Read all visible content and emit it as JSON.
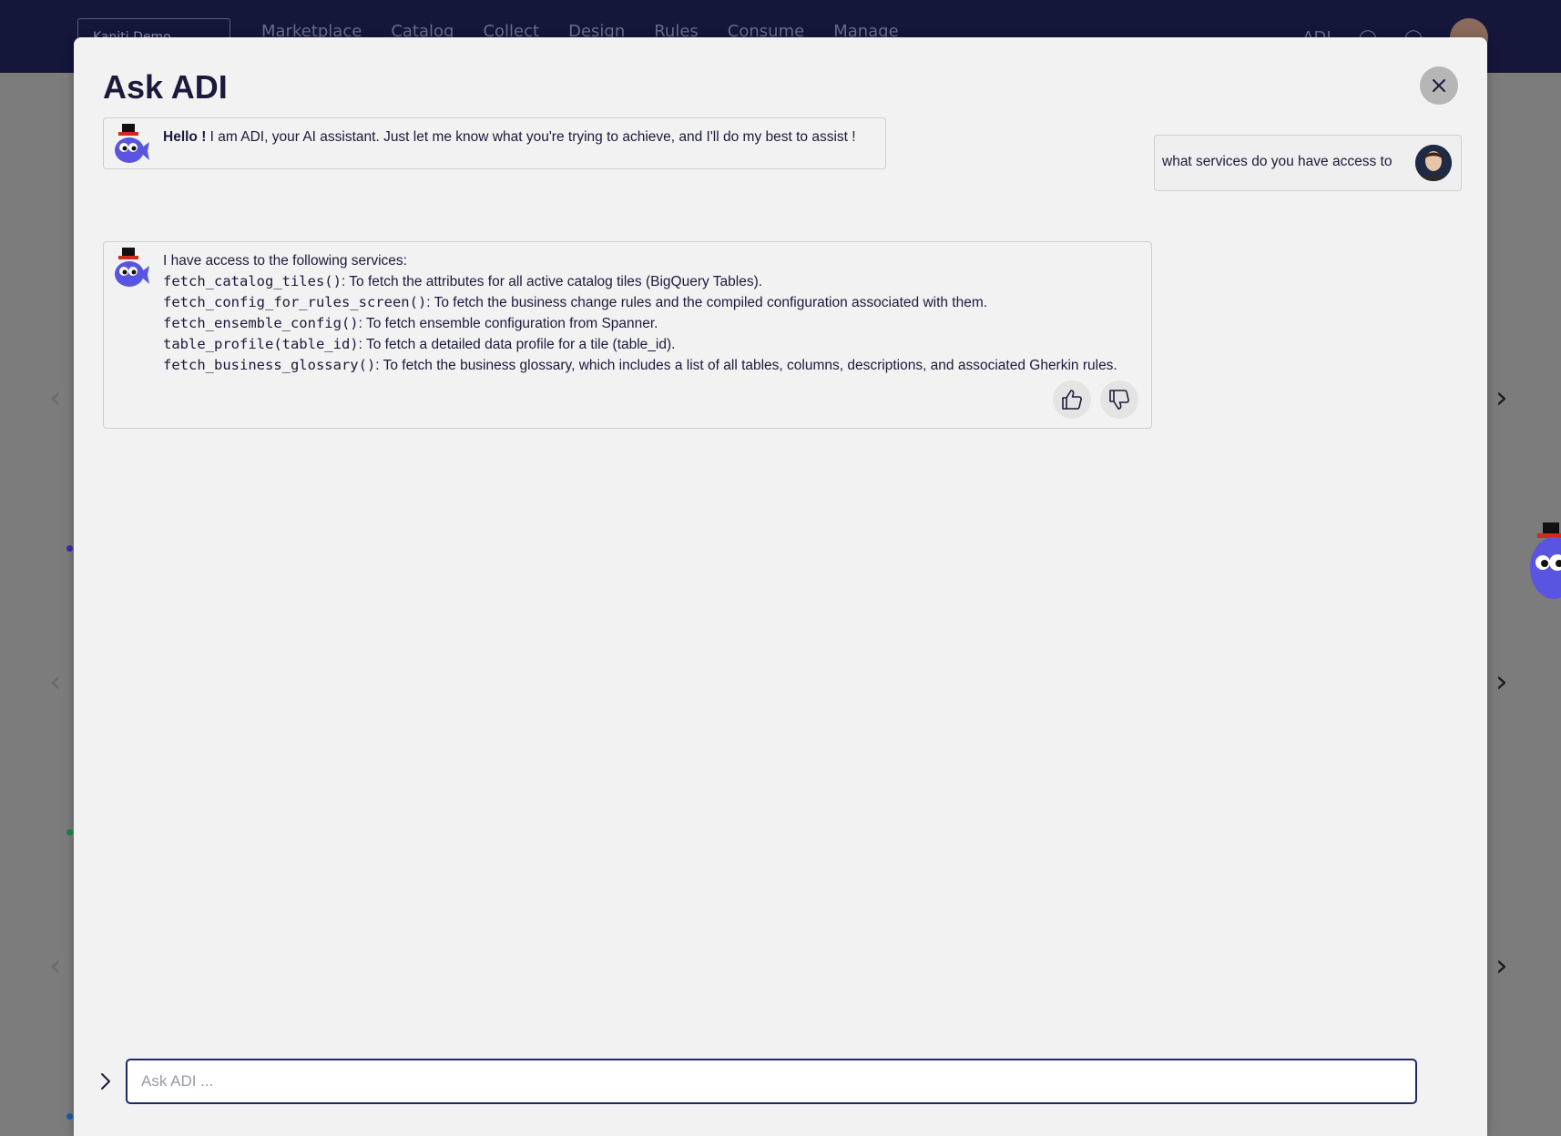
{
  "background": {
    "org_selector": "Kaniti Demo",
    "nav_items": [
      "Marketplace",
      "Catalog",
      "Collect",
      "Design",
      "Rules",
      "Consume",
      "Manage"
    ],
    "adi_label": "ADI"
  },
  "modal": {
    "title": "Ask ADI",
    "close_icon": "close-icon"
  },
  "messages": {
    "greeting": {
      "bold": "Hello !",
      "text": " I am ADI, your AI assistant. Just let me know what you're trying to achieve, and I'll do my best to assist !"
    },
    "user_query": "what services do you have access to",
    "services_reply": {
      "intro": "I have access to the following services:",
      "items": [
        {
          "fn": "fetch_catalog_tiles()",
          "desc": ": To fetch the attributes for all active catalog tiles (BigQuery Tables)."
        },
        {
          "fn": "fetch_config_for_rules_screen()",
          "desc": ": To fetch the business change rules and the compiled configuration associated with them."
        },
        {
          "fn": "fetch_ensemble_config()",
          "desc": ": To fetch ensemble configuration from Spanner."
        },
        {
          "fn": "table_profile(table_id)",
          "desc": ": To fetch a detailed data profile for a tile (table_id)."
        },
        {
          "fn": "fetch_business_glossary()",
          "desc": ": To fetch the business glossary, which includes a list of all tables, columns, descriptions, and associated Gherkin rules."
        }
      ]
    }
  },
  "input": {
    "placeholder": "Ask ADI ..."
  },
  "colors": {
    "accent": "#1b2a6b",
    "text": "#1b1a3c",
    "mascot": "#5a55e0"
  }
}
